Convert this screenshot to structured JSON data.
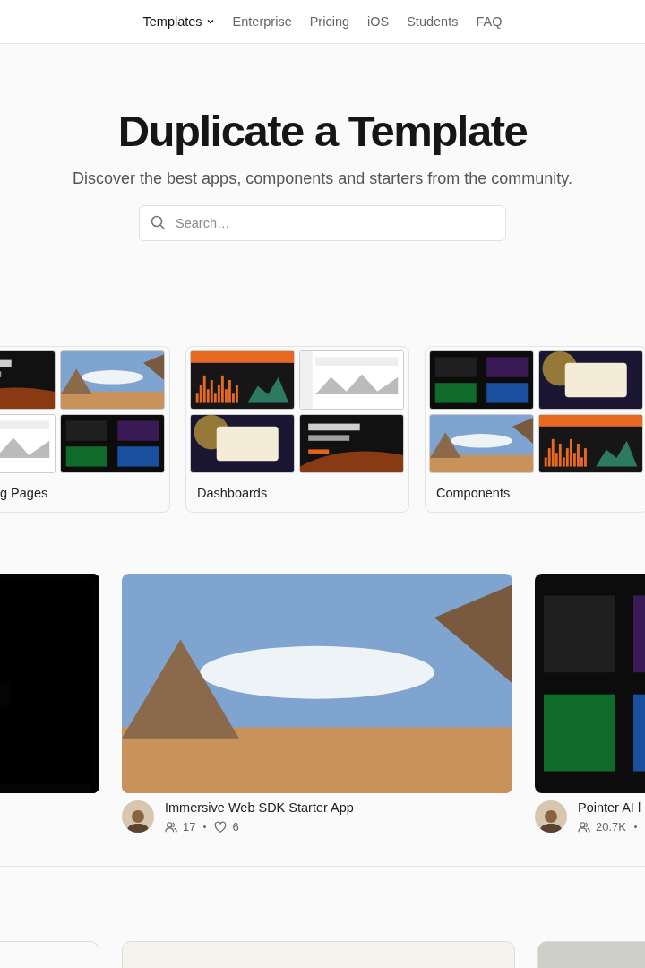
{
  "nav": {
    "items": [
      {
        "label": "Templates",
        "selected": true,
        "dropdown": true
      },
      {
        "label": "Enterprise",
        "selected": false,
        "dropdown": false
      },
      {
        "label": "Pricing",
        "selected": false,
        "dropdown": false
      },
      {
        "label": "iOS",
        "selected": false,
        "dropdown": false
      },
      {
        "label": "Students",
        "selected": false,
        "dropdown": false
      },
      {
        "label": "FAQ",
        "selected": false,
        "dropdown": false
      }
    ]
  },
  "hero": {
    "title": "Duplicate a Template",
    "subtitle": "Discover the best apps, components and starters from the community."
  },
  "search": {
    "placeholder": "Search…"
  },
  "categories": [
    {
      "label": "g Pages",
      "kind": "partial"
    },
    {
      "label": "Dashboards",
      "kind": "full"
    },
    {
      "label": "Components",
      "kind": "full"
    }
  ],
  "featured": [
    {
      "kind": "partial"
    },
    {
      "kind": "full",
      "title": "Immersive Web SDK Starter App",
      "users": "17",
      "likes": "6"
    },
    {
      "kind": "edge",
      "title": "Pointer AI l",
      "users": "20.7K"
    }
  ],
  "more": [
    {
      "kind": "partial"
    },
    {
      "kind": "full"
    },
    {
      "kind": "edge"
    }
  ]
}
